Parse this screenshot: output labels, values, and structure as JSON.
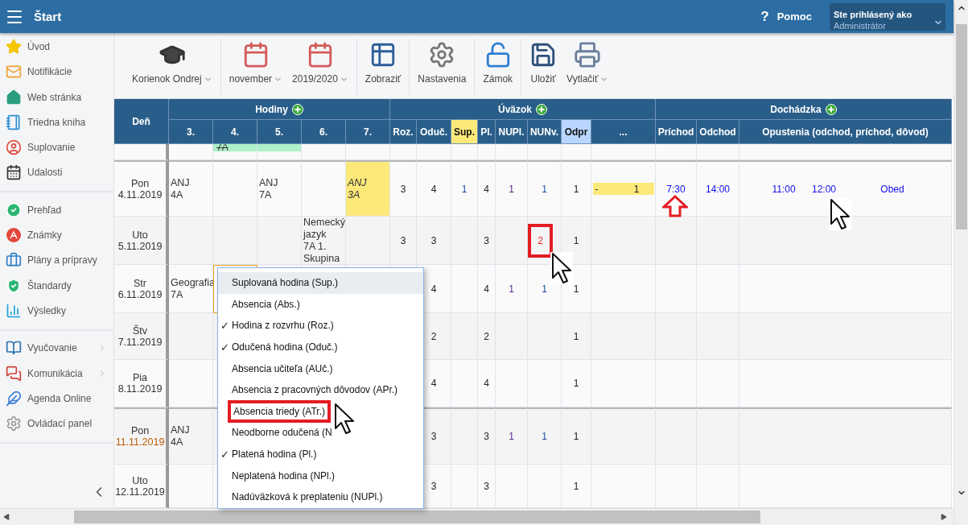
{
  "app_bar": {
    "title": "Štart",
    "help_glyph": "?",
    "help_label": "Pomoc",
    "user": {
      "caption": "Ste prihlásený ako",
      "name": "Administrátor"
    }
  },
  "sidebar": {
    "groups": [
      [
        {
          "label": "Úvod",
          "has_submenu": false
        },
        {
          "label": "Notifikácie",
          "has_submenu": false
        },
        {
          "label": "Web stránka",
          "has_submenu": false
        },
        {
          "label": "Triedna kniha",
          "has_submenu": false
        },
        {
          "label": "Suplovanie",
          "has_submenu": false
        },
        {
          "label": "Udalosti",
          "has_submenu": false
        }
      ],
      [
        {
          "label": "Prehľad",
          "has_submenu": false
        },
        {
          "label": "Známky",
          "has_submenu": false
        },
        {
          "label": "Plány a prípravy",
          "has_submenu": false
        },
        {
          "label": "Štandardy",
          "has_submenu": false
        },
        {
          "label": "Výsledky",
          "has_submenu": false
        }
      ],
      [
        {
          "label": "Vyučovanie",
          "has_submenu": true
        },
        {
          "label": "Komunikácia",
          "has_submenu": true
        },
        {
          "label": "Agenda Online",
          "has_submenu": false
        },
        {
          "label": "Ovládací panel",
          "has_submenu": false
        }
      ]
    ]
  },
  "toolbar": {
    "groups": [
      [
        {
          "label": "Korienok Ondrej",
          "dropdown": true
        }
      ],
      [
        {
          "label": "november",
          "dropdown": true
        },
        {
          "label": "2019/2020",
          "dropdown": true
        }
      ],
      [
        {
          "label": "Zobraziť",
          "dropdown": false
        }
      ],
      [
        {
          "label": "Nastavenia",
          "dropdown": false
        }
      ],
      [
        {
          "label": "Zámok",
          "dropdown": false
        }
      ],
      [
        {
          "label": "Uložiť",
          "dropdown": false
        },
        {
          "label": "Vytlačiť",
          "dropdown": true
        }
      ]
    ]
  },
  "table": {
    "day_header": "Deň",
    "hours_header": "Hodiny",
    "load_header": "Úväzok",
    "attendance_header": "Dochádzka",
    "hour_columns": [
      "3.",
      "4.",
      "5.",
      "6.",
      "7."
    ],
    "load_columns": [
      {
        "label": "Roz."
      },
      {
        "label": "Oduč."
      },
      {
        "label": "Sup.",
        "color": "#fde97a"
      },
      {
        "label": "Pl."
      },
      {
        "label": "NUPl."
      },
      {
        "label": "NUNv."
      },
      {
        "label": "Odpr",
        "color": "#b9d6ff"
      },
      {
        "label": "..."
      }
    ],
    "attendance_columns": [
      "Príchod",
      "Odchod",
      "Opustenia (odchod, príchod, dôvod)"
    ],
    "clipped_row": {
      "hours": [
        {
          "kind": "empty"
        },
        {
          "kind": "chip",
          "text": "7A"
        },
        {
          "kind": "chip"
        },
        {
          "kind": "empty"
        },
        {
          "kind": "empty"
        }
      ]
    },
    "rows": [
      {
        "day": "Pon",
        "date": "4.11.2019",
        "date_marked": false,
        "week_start": true,
        "hours": [
          {
            "kind": "lesson",
            "text": "ANJ\n4A"
          },
          {
            "kind": "empty"
          },
          {
            "kind": "lesson",
            "text": "ANJ\n7A"
          },
          {
            "kind": "empty"
          },
          {
            "kind": "substitute",
            "text": "ANJ\n3A"
          }
        ],
        "counts": [
          {
            "kind": "value",
            "text": "3"
          },
          {
            "kind": "value",
            "text": "4"
          },
          {
            "kind": "value",
            "text": "1"
          },
          {
            "kind": "value",
            "text": "4"
          },
          {
            "kind": "value",
            "text": "1"
          },
          {
            "kind": "value",
            "text": "1"
          },
          {
            "kind": "value",
            "text": "1"
          }
        ],
        "extra": {
          "dash": "-",
          "value": "1"
        },
        "arrival": "7:30",
        "departure": "14:00",
        "leaves": [
          "11:00",
          "12:00",
          "Obed"
        ]
      },
      {
        "day": "Uto",
        "date": "5.11.2019",
        "date_marked": false,
        "week_start": false,
        "hours": [
          {
            "kind": "empty"
          },
          {
            "kind": "empty"
          },
          {
            "kind": "empty"
          },
          {
            "kind": "lesson",
            "text": "Nemecký jazyk 7A 1. Skupina"
          },
          {
            "kind": "empty"
          }
        ],
        "counts": [
          {
            "kind": "value",
            "text": "3"
          },
          {
            "kind": "value",
            "text": "3"
          },
          {
            "kind": "blank"
          },
          {
            "kind": "value",
            "text": "3"
          },
          {
            "kind": "blank"
          },
          {
            "kind": "flagged",
            "text": "2"
          },
          {
            "kind": "value",
            "text": "1"
          }
        ]
      },
      {
        "day": "Str",
        "date": "6.11.2019",
        "date_marked": false,
        "week_start": false,
        "hours": [
          {
            "kind": "lesson",
            "text": "Geografia\n7A"
          },
          {
            "kind": "selected"
          },
          {
            "kind": "empty"
          },
          {
            "kind": "empty"
          },
          {
            "kind": "empty"
          }
        ],
        "counts": [
          {
            "kind": "blank"
          },
          {
            "kind": "value",
            "text": "4"
          },
          {
            "kind": "blank"
          },
          {
            "kind": "value",
            "text": "4"
          },
          {
            "kind": "value",
            "text": "1"
          },
          {
            "kind": "value",
            "text": "1"
          },
          {
            "kind": "value",
            "text": "1"
          }
        ]
      },
      {
        "day": "Štv",
        "date": "7.11.2019",
        "date_marked": false,
        "week_start": false,
        "hours": [
          {
            "kind": "empty"
          },
          {
            "kind": "empty"
          },
          {
            "kind": "empty"
          },
          {
            "kind": "empty"
          },
          {
            "kind": "empty"
          }
        ],
        "counts": [
          {
            "kind": "blank"
          },
          {
            "kind": "value",
            "text": "2"
          },
          {
            "kind": "blank"
          },
          {
            "kind": "value",
            "text": "2"
          },
          {
            "kind": "blank"
          },
          {
            "kind": "blank"
          },
          {
            "kind": "value",
            "text": "1"
          }
        ]
      },
      {
        "day": "Pia",
        "date": "8.11.2019",
        "date_marked": false,
        "week_start": false,
        "hours": [
          {
            "kind": "empty"
          },
          {
            "kind": "empty"
          },
          {
            "kind": "empty"
          },
          {
            "kind": "empty"
          },
          {
            "kind": "empty"
          }
        ],
        "counts": [
          {
            "kind": "blank"
          },
          {
            "kind": "value",
            "text": "4"
          },
          {
            "kind": "blank"
          },
          {
            "kind": "value",
            "text": "4"
          },
          {
            "kind": "blank"
          },
          {
            "kind": "blank"
          },
          {
            "kind": "value",
            "text": "1"
          }
        ]
      },
      {
        "day": "Pon",
        "date": "11.11.2019",
        "date_marked": true,
        "week_start": true,
        "hours": [
          {
            "kind": "lesson",
            "text": "ANJ\n4A"
          },
          {
            "kind": "empty"
          },
          {
            "kind": "empty"
          },
          {
            "kind": "empty"
          },
          {
            "kind": "empty"
          }
        ],
        "counts": [
          {
            "kind": "blank"
          },
          {
            "kind": "value",
            "text": "3"
          },
          {
            "kind": "blank"
          },
          {
            "kind": "value",
            "text": "3"
          },
          {
            "kind": "value",
            "text": "1"
          },
          {
            "kind": "value",
            "text": "1"
          },
          {
            "kind": "value",
            "text": "1"
          }
        ]
      },
      {
        "day": "Uto",
        "date": "12.11.2019",
        "date_marked": false,
        "week_start": false,
        "hours": [
          {
            "kind": "empty"
          },
          {
            "kind": "empty"
          },
          {
            "kind": "empty"
          },
          {
            "kind": "empty"
          },
          {
            "kind": "empty"
          }
        ],
        "counts": [
          {
            "kind": "blank"
          },
          {
            "kind": "value",
            "text": "3"
          },
          {
            "kind": "blank"
          },
          {
            "kind": "value",
            "text": "3"
          },
          {
            "kind": "blank"
          },
          {
            "kind": "blank"
          },
          {
            "kind": "value",
            "text": "1"
          }
        ]
      }
    ]
  },
  "context_menu": {
    "items": [
      {
        "label": "Suplovaná hodina (Sup.)",
        "checked": false,
        "hovered": true,
        "marked": false
      },
      {
        "label": "Absencia (Abs.)",
        "checked": false,
        "hovered": false,
        "marked": false
      },
      {
        "label": "Hodina z rozvrhu (Roz.)",
        "checked": true,
        "hovered": false,
        "marked": false
      },
      {
        "label": "Odučená hodina (Oduč.)",
        "checked": true,
        "hovered": false,
        "marked": false
      },
      {
        "label": "Absencia učiteľa (AUč.)",
        "checked": false,
        "hovered": false,
        "marked": false
      },
      {
        "label": "Absencia z pracovných dôvodov (APr.)",
        "checked": false,
        "hovered": false,
        "marked": false
      },
      {
        "label": "Absencia triedy (ATr.)",
        "checked": false,
        "hovered": false,
        "marked": true
      },
      {
        "label": "Neodborne odučená (N",
        "checked": false,
        "hovered": false,
        "marked": false
      },
      {
        "label": "Platená hodina (Pl.)",
        "checked": true,
        "hovered": false,
        "marked": false
      },
      {
        "label": "Neplatená hodina (NPl.)",
        "checked": false,
        "hovered": false,
        "marked": false
      },
      {
        "label": "Nadúväzková k preplateniu (NUPl.)",
        "checked": false,
        "hovered": false,
        "marked": false
      }
    ],
    "check_glyph": "✓"
  }
}
